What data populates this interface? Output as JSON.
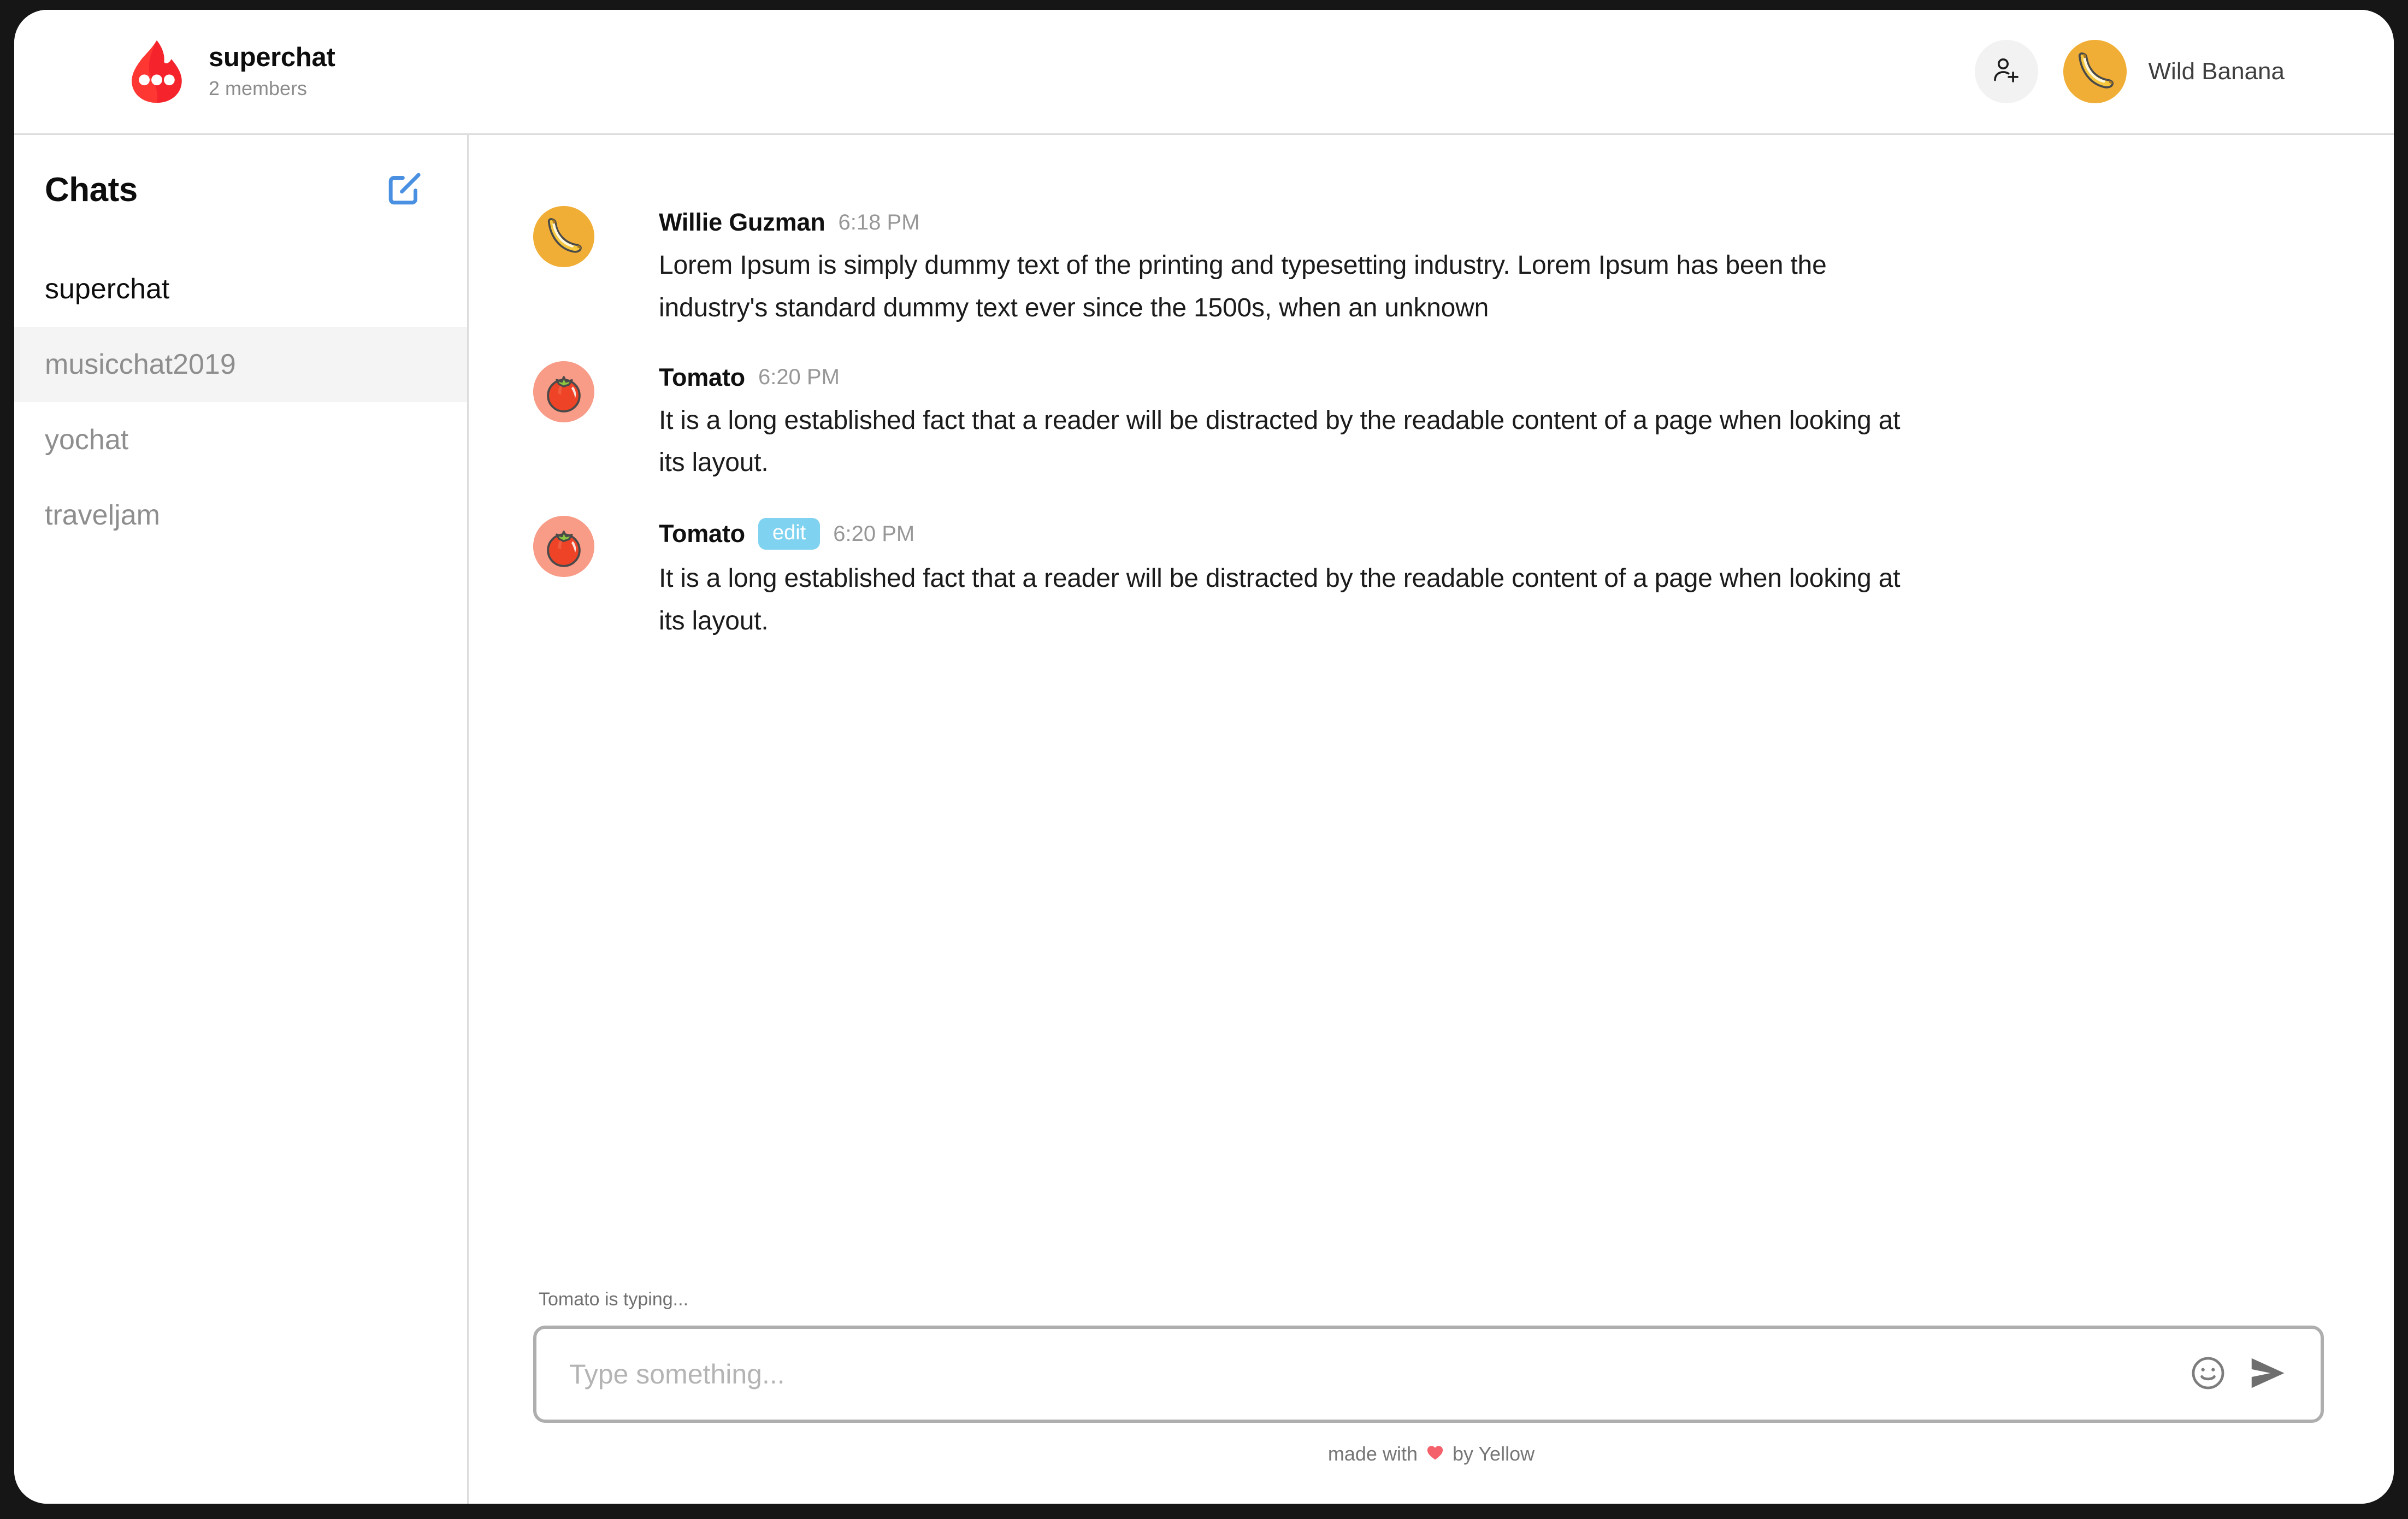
{
  "header": {
    "logo_icon": "flame-logo",
    "workspace_title": "superchat",
    "members_label": "2 members",
    "add_member_icon": "person-add-icon",
    "user": {
      "avatar_icon": "banana-avatar",
      "name": "Wild Banana"
    }
  },
  "sidebar": {
    "title": "Chats",
    "compose_icon": "compose-icon",
    "items": [
      {
        "label": "superchat",
        "active": true,
        "highlight": false
      },
      {
        "label": "musicchat2019",
        "active": false,
        "highlight": true
      },
      {
        "label": "yochat",
        "active": false,
        "highlight": false
      },
      {
        "label": "traveljam",
        "active": false,
        "highlight": false
      }
    ]
  },
  "chat": {
    "messages": [
      {
        "avatar_icon": "banana-avatar",
        "avatar_kind": "banana",
        "author": "Willie Guzman",
        "time": "6:18 PM",
        "badge": "",
        "text": "Lorem Ipsum is simply dummy text of the printing and typesetting industry. Lorem Ipsum has been the industry's standard dummy text ever since the 1500s, when an unknown"
      },
      {
        "avatar_icon": "tomato-avatar",
        "avatar_kind": "tomato",
        "author": "Tomato",
        "time": "6:20 PM",
        "badge": "",
        "text": "It is a long established fact that a reader will be distracted by the readable content of a page when looking at its layout."
      },
      {
        "avatar_icon": "tomato-avatar",
        "avatar_kind": "tomato",
        "author": "Tomato",
        "time": "6:20 PM",
        "badge": "edit",
        "text": "It is a long established fact that a reader will be distracted by the readable content of a page when looking at its layout."
      }
    ]
  },
  "composer": {
    "typing_indicator": "Tomato is typing...",
    "input_value": "",
    "input_placeholder": "Type something...",
    "emoji_icon": "smiley-icon",
    "send_icon": "send-icon"
  },
  "footer": {
    "made_with": "made with",
    "heart_icon": "heart-icon",
    "by": "by Yellow"
  },
  "colors": {
    "brand_red": "#F5232C",
    "accent_blue": "#4A90E2",
    "edit_badge": "#7FD3F0",
    "banana_bg": "#F0AE36",
    "tomato_bg": "#F89B87",
    "heart": "#F4616A",
    "highlight_row": "#f4f4f4"
  }
}
